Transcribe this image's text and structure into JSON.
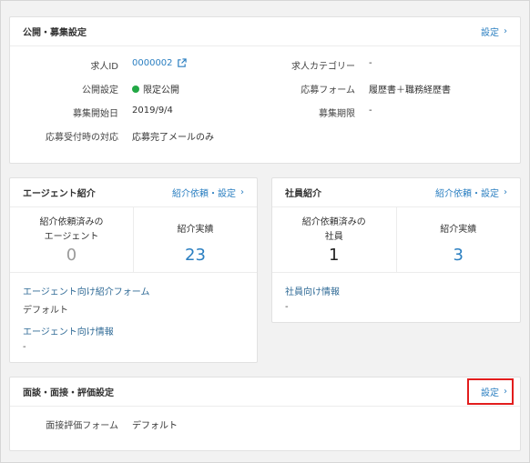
{
  "public_card": {
    "title": "公開・募集設定",
    "settings_link": "設定",
    "job_id_label": "求人ID",
    "job_id_value": "0000002",
    "publish_label": "公開設定",
    "publish_value": "限定公開",
    "publish_status_color": "#22a845",
    "start_label": "募集開始日",
    "start_value": "2019/9/4",
    "response_label": "応募受付時の対応",
    "response_value": "応募完了メールのみ",
    "category_label": "求人カテゴリー",
    "category_value": "-",
    "form_label": "応募フォーム",
    "form_value": "履歴書＋職務経歴書",
    "deadline_label": "募集期限",
    "deadline_value": "-"
  },
  "agent_card": {
    "title": "エージェント紹介",
    "link": "紹介依頼・設定",
    "stat1_label_line1": "紹介依頼済みの",
    "stat1_label_line2": "エージェント",
    "stat1_value": "0",
    "stat2_label": "紹介実績",
    "stat2_value": "23",
    "form_label": "エージェント向け紹介フォーム",
    "form_value": "デフォルト",
    "info_label": "エージェント向け情報",
    "info_value": "-"
  },
  "employee_card": {
    "title": "社員紹介",
    "link": "紹介依頼・設定",
    "stat1_label_line1": "紹介依頼済みの",
    "stat1_label_line2": "社員",
    "stat1_value": "1",
    "stat2_label": "紹介実績",
    "stat2_value": "3",
    "info_label": "社員向け情報",
    "info_value": "-"
  },
  "interview_card": {
    "title": "面談・面接・評価設定",
    "settings_link": "設定",
    "form_label": "面接評価フォーム",
    "form_value": "デフォルト",
    "highlight_color": "#e21d1d"
  },
  "colors": {
    "accent": "#2b7fc1",
    "background": "#f2f2f2"
  }
}
